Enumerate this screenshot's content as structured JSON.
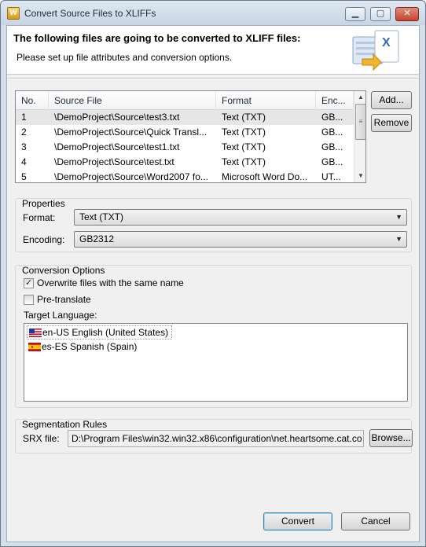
{
  "window": {
    "title": "Convert Source Files to XLIFFs",
    "controls": {
      "minimize": "▁",
      "maximize": "▢",
      "close": "✕"
    }
  },
  "header": {
    "title": "The following files are going to be converted to XLIFF files:",
    "subtitle": "Please set up file attributes and conversion options.",
    "logo_letter": "X"
  },
  "files_table": {
    "columns": [
      "No.",
      "Source File",
      "Format",
      "Enc..."
    ],
    "rows": [
      {
        "no": "1",
        "source": "\\DemoProject\\Source\\test3.txt",
        "format": "Text (TXT)",
        "encoding": "GB..."
      },
      {
        "no": "2",
        "source": "\\DemoProject\\Source\\Quick Transl...",
        "format": "Text (TXT)",
        "encoding": "GB..."
      },
      {
        "no": "3",
        "source": "\\DemoProject\\Source\\test1.txt",
        "format": "Text (TXT)",
        "encoding": "GB..."
      },
      {
        "no": "4",
        "source": "\\DemoProject\\Source\\test.txt",
        "format": "Text (TXT)",
        "encoding": "GB..."
      },
      {
        "no": "5",
        "source": "\\DemoProject\\Source\\Word2007 fo...",
        "format": "Microsoft Word Do...",
        "encoding": "UT..."
      }
    ],
    "selected_row": 0
  },
  "side_buttons": {
    "add": "Add...",
    "remove": "Remove"
  },
  "properties": {
    "title": "Properties",
    "format_label": "Format:",
    "format_value": "Text (TXT)",
    "encoding_label": "Encoding:",
    "encoding_value": "GB2312"
  },
  "conversion": {
    "title": "Conversion Options",
    "overwrite_label": "Overwrite files with the same name",
    "overwrite_checked": true,
    "pretranslate_label": "Pre-translate",
    "pretranslate_checked": false,
    "target_language_label": "Target Language:",
    "languages": [
      {
        "code": "en-US",
        "label": "en-US English (United States)",
        "flag": "us-flag-icon"
      },
      {
        "code": "es-ES",
        "label": "es-ES Spanish (Spain)",
        "flag": "es-flag-icon"
      }
    ]
  },
  "segmentation": {
    "title": "Segmentation Rules",
    "srx_label": "SRX file:",
    "srx_value": "D:\\Program Files\\win32.win32.x86\\configuration\\net.heartsome.cat.co",
    "browse": "Browse..."
  },
  "footer": {
    "convert": "Convert",
    "cancel": "Cancel"
  },
  "colors": {
    "window_frame": "#d6dfe9",
    "close_button": "#c4442f",
    "selected_row": "#e6e6e6",
    "default_button_border": "#3c7fb1"
  }
}
